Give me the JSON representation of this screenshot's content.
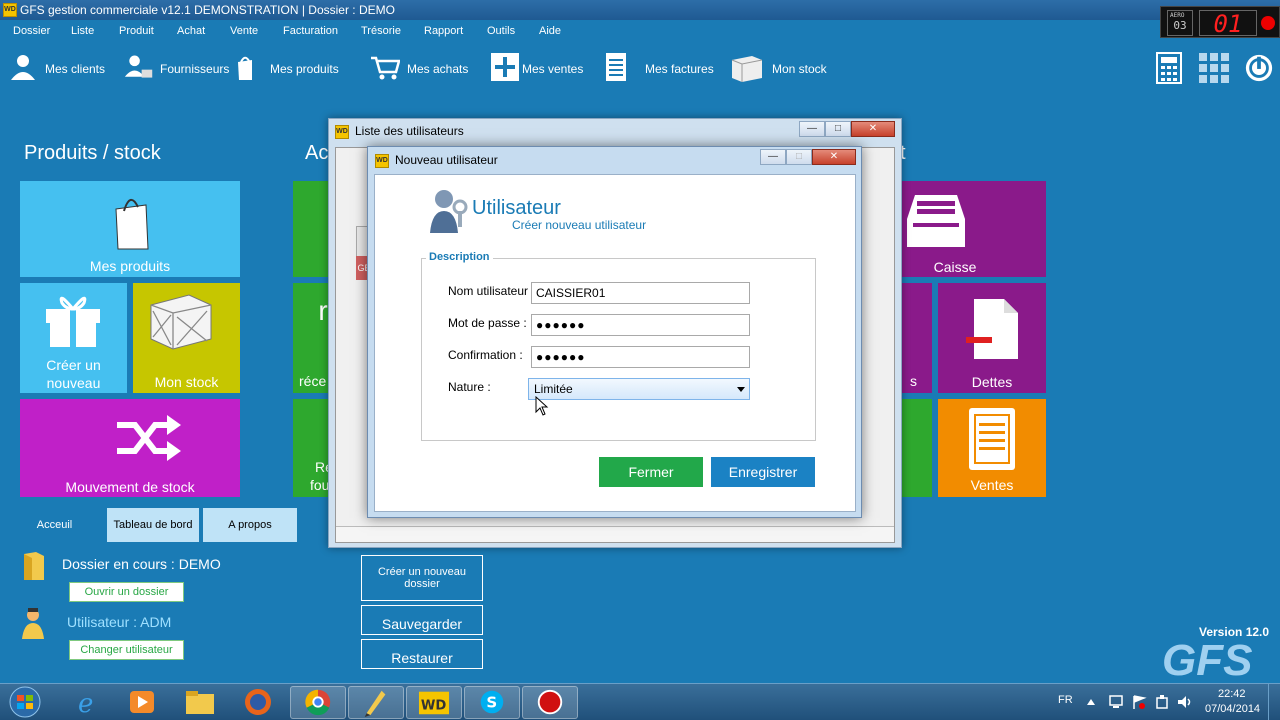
{
  "window": {
    "title": "GFS gestion commerciale v12.1  DEMONSTRATION | Dossier : DEMO",
    "app_icon_text": "WD"
  },
  "aero_clock": {
    "small_label": "AERO",
    "small_value": "03",
    "big_value": "01"
  },
  "menu": {
    "items": [
      "Dossier",
      "Liste",
      "Produit",
      "Achat",
      "Vente",
      "Facturation",
      "Trésorie",
      "Rapport",
      "Outils",
      "Aide"
    ]
  },
  "toolbar": {
    "items": [
      {
        "label": "Mes clients",
        "icon": "person-icon"
      },
      {
        "label": "Fournisseurs",
        "icon": "supplier-icon"
      },
      {
        "label": "Mes produits",
        "icon": "bag-icon"
      },
      {
        "label": "Mes achats",
        "icon": "cart-icon"
      },
      {
        "label": "Mes ventes",
        "icon": "plus-box-icon"
      },
      {
        "label": "Mes factures",
        "icon": "invoice-icon"
      },
      {
        "label": "Mon stock",
        "icon": "crate-icon"
      }
    ],
    "right_icons": [
      "calculator-icon",
      "grid-icon",
      "power-icon"
    ]
  },
  "sections": {
    "left_title": "Produits / stock",
    "middle_title": "Ac",
    "right_title_fragment": "t"
  },
  "tiles": {
    "mes_produits": "Mes produits",
    "creer_nouveau_l1": "Créer un",
    "creer_nouveau_l2": "nouveau",
    "mon_stock": "Mon stock",
    "mouvement_stock": "Mouvement de stock",
    "mid_fragment_1": "r",
    "mid_fragment_2": "réce",
    "mid_fragment_3": "Re",
    "mid_fragment_4": "fou",
    "caisse": "Caisse",
    "dettes": "Dettes",
    "ventes": "Ventes",
    "right_fragment": "s"
  },
  "colors": {
    "light_blue_tile": "#45c0f0",
    "olive_tile": "#c6c600",
    "magenta_tile": "#c020c8",
    "green_tile": "#2ea82e",
    "purple_tile": "#8a1a8a",
    "orange_tile": "#f28c00",
    "accent_blue": "#1a7bb5",
    "green_button": "#22a84a",
    "blue_button": "#1b82c4"
  },
  "bottom_tabs": [
    "Acceuil",
    "Tableau de bord",
    "A propos"
  ],
  "info": {
    "dossier": "Dossier en cours : DEMO",
    "ouvrir_btn": "Ouvrir un dossier",
    "utilisateur": "Utilisateur : ADM",
    "changer_btn": "Changer utilisateur"
  },
  "actions": {
    "creer_dossier_l1": "Créer un nouveau",
    "creer_dossier_l2": "dossier",
    "sauvegarder": "Sauvegarder",
    "restaurer": "Restaurer"
  },
  "branding": {
    "version": "Version 12.0",
    "logo": "GFS"
  },
  "bg_window": {
    "title": "Liste des utilisateurs",
    "fragment": "GE"
  },
  "dialog": {
    "title": "Nouveau utilisateur",
    "heading": "Utilisateur",
    "subheading": "Créer nouveau utilisateur",
    "group_label": "Description",
    "fields": {
      "username_label": "Nom utilisateur :",
      "username_value": "CAISSIER01",
      "password_label": "Mot de passe :",
      "password_value": "●●●●●●",
      "confirm_label": "Confirmation :",
      "confirm_value": "●●●●●●",
      "nature_label": "Nature :",
      "nature_value": "Limitée"
    },
    "buttons": {
      "fermer": "Fermer",
      "enregistrer": "Enregistrer"
    }
  },
  "taskbar": {
    "apps": [
      "start-orb-icon",
      "ie-icon",
      "media-player-icon",
      "explorer-icon",
      "firefox-icon",
      "chrome-icon",
      "pen-tool-icon",
      "windev-icon",
      "skype-icon",
      "record-icon"
    ],
    "lang": "FR",
    "time": "22:42",
    "date": "07/04/2014"
  }
}
